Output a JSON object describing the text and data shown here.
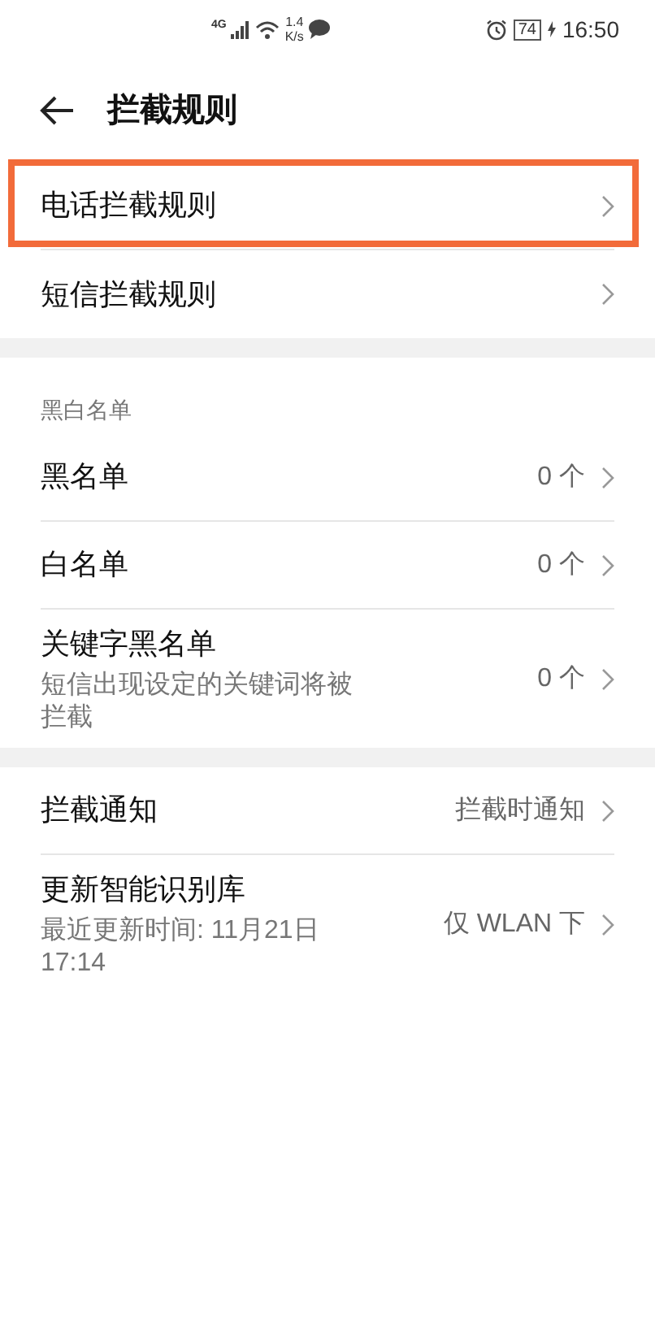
{
  "status_bar": {
    "network": "4G",
    "speed_value": "1.4",
    "speed_unit": "K/s",
    "battery": "74",
    "time": "16:50"
  },
  "header": {
    "title": "拦截规则"
  },
  "sections": [
    {
      "rows": [
        {
          "title": "电话拦截规则",
          "highlighted": true
        },
        {
          "title": "短信拦截规则",
          "highlighted": false
        }
      ]
    },
    {
      "heading": "黑白名单",
      "rows": [
        {
          "title": "黑名单",
          "value": "0 个",
          "highlighted": false
        },
        {
          "title": "白名单",
          "value": "0 个",
          "highlighted": false
        },
        {
          "title": "关键字黑名单",
          "subtitle": "短信出现设定的关键词将被拦截",
          "value": "0 个",
          "highlighted": false
        }
      ]
    },
    {
      "rows": [
        {
          "title": "拦截通知",
          "value": "拦截时通知",
          "highlighted": false
        },
        {
          "title": "更新智能识别库",
          "subtitle": "最近更新时间: 11月21日 17:14",
          "value": "仅 WLAN 下",
          "highlighted": false
        }
      ]
    }
  ]
}
